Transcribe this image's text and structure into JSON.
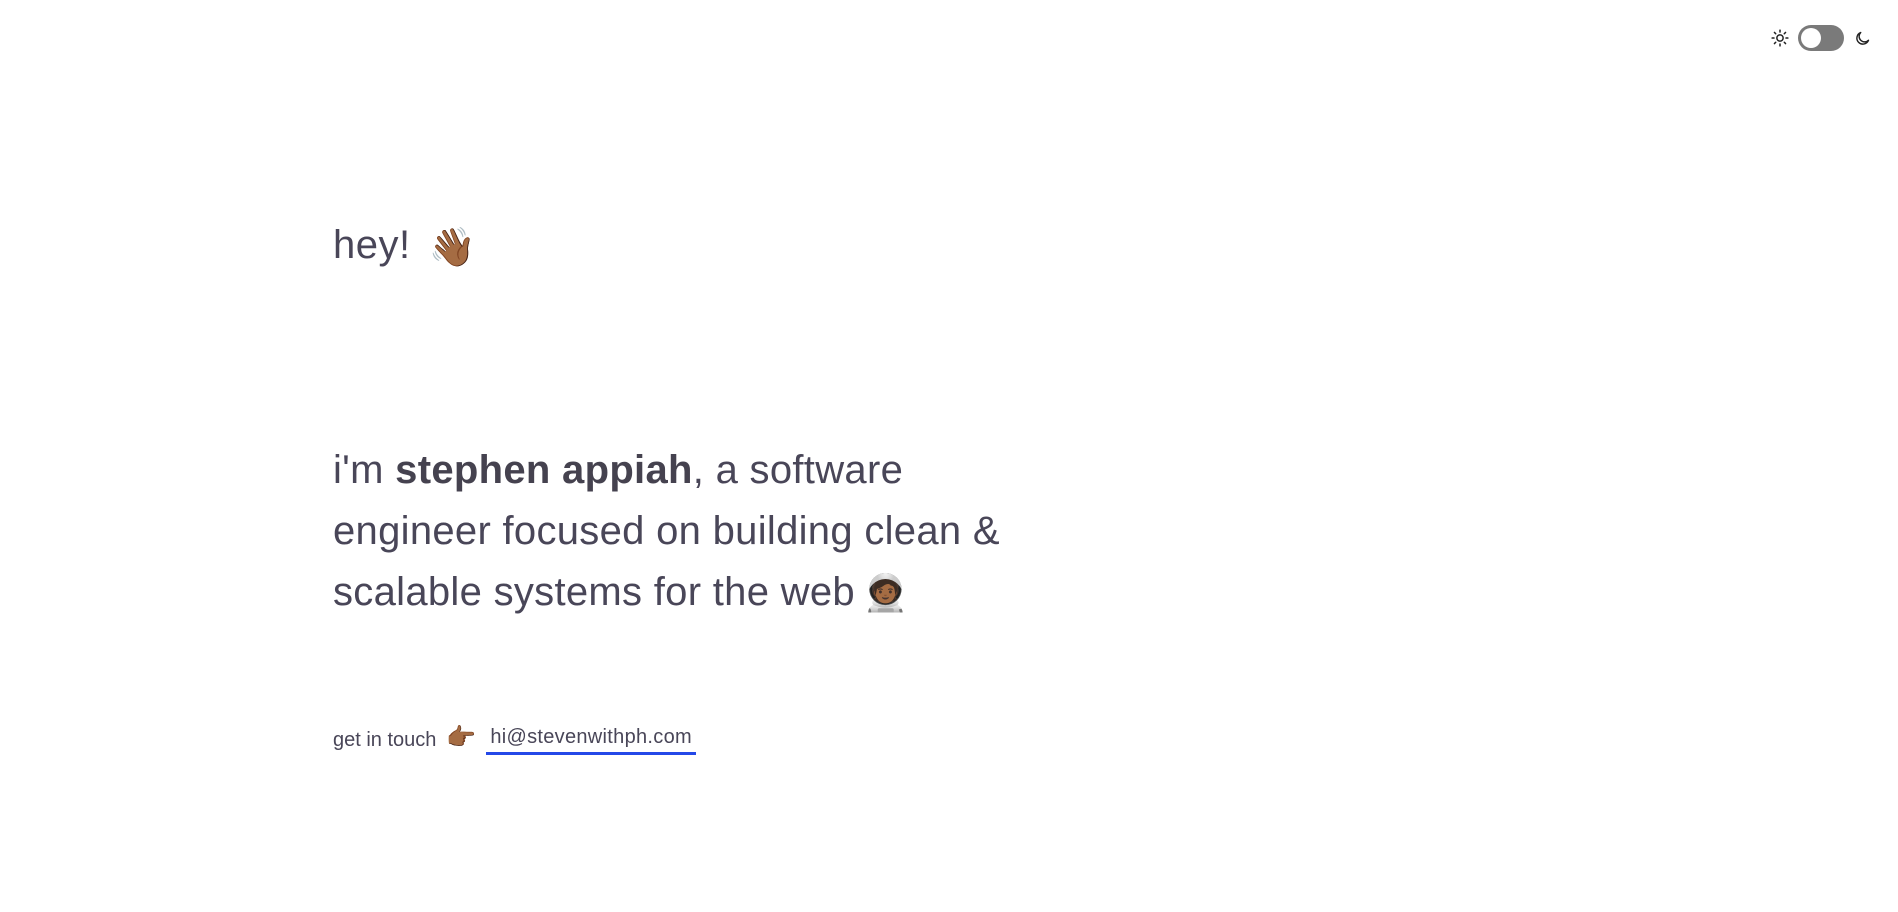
{
  "theme_toggle": {
    "light_icon": "sun-icon",
    "dark_icon": "moon-icon",
    "state": "light"
  },
  "greeting": {
    "text": "hey!",
    "emoji": "👋🏾"
  },
  "intro": {
    "prefix": "i'm ",
    "name": "stephen appiah",
    "suffix": ", a software engineer focused on building clean & scalable systems for the web",
    "emoji": "🧑🏾‍🚀"
  },
  "contact": {
    "label": "get in touch",
    "emoji": "👉🏾",
    "email": "hi@stevenwithph.com",
    "link_underline_color": "#2448e8"
  },
  "colors": {
    "text": "#494658",
    "toggle_track": "#7a7a7a",
    "background": "#ffffff"
  }
}
